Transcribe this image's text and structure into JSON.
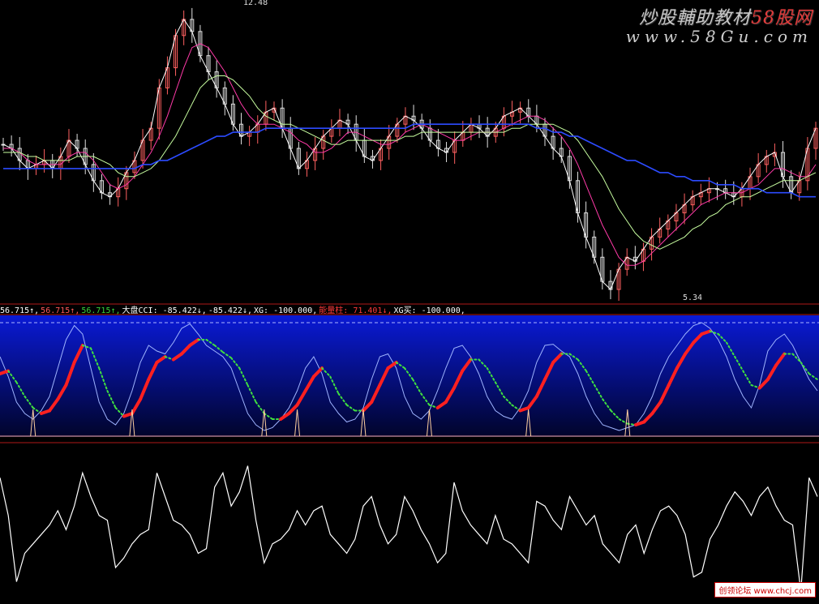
{
  "watermark": {
    "brand_main": "炒股輔助教材",
    "brand_accent": "58股网",
    "url": "www.58Gu.com"
  },
  "credit": "创领论坛 www.chcj.com",
  "labels": {
    "high": "12.48",
    "low": "5.34"
  },
  "legend": [
    {
      "text": "56.715↑",
      "color": "#ffffff"
    },
    {
      "text": "56.715↑",
      "color": "#ff5a5a"
    },
    {
      "text": "56.715↑",
      "color": "#3ad23a"
    },
    {
      "text": "大盘CCI: -85.422↓",
      "color": "#ffffff"
    },
    {
      "text": "-85.422↓",
      "color": "#ffffff"
    },
    {
      "text": "XG: -100.000",
      "color": "#ffffff"
    },
    {
      "text": "能量柱: 71.401↓",
      "color": "#ff3b3b"
    },
    {
      "text": "XG买: -100.000",
      "color": "#ffffff"
    }
  ],
  "colors": {
    "price": "#ffffff",
    "ma5": "#ffffff",
    "ma10": "#ff3aa8",
    "ma20": "#c8ffa0",
    "ma60": "#2c4bff",
    "osc_rise": "#ff2020",
    "osc_fall": "#40e040",
    "osc_thin": "#9fb4ff",
    "panel_grad_top": "#0a1ad6",
    "panel_grad_bottom": "#01042a"
  },
  "chart_data": [
    {
      "type": "line",
      "title": "",
      "ylim": [
        5.34,
        12.48
      ],
      "x": [
        0,
        1,
        2,
        3,
        4,
        5,
        6,
        7,
        8,
        9,
        10,
        11,
        12,
        13,
        14,
        15,
        16,
        17,
        18,
        19,
        20,
        21,
        22,
        23,
        24,
        25,
        26,
        27,
        28,
        29,
        30,
        31,
        32,
        33,
        34,
        35,
        36,
        37,
        38,
        39,
        40,
        41,
        42,
        43,
        44,
        45,
        46,
        47,
        48,
        49,
        50,
        51,
        52,
        53,
        54,
        55,
        56,
        57,
        58,
        59,
        60,
        61,
        62,
        63,
        64,
        65,
        66,
        67,
        68,
        69,
        70,
        71,
        72,
        73,
        74,
        75,
        76,
        77,
        78,
        79,
        80,
        81,
        82,
        83,
        84,
        85,
        86,
        87,
        88,
        89,
        90,
        91,
        92,
        93,
        94,
        95,
        96,
        97,
        98,
        99
      ],
      "series": [
        {
          "values": [
            9.1,
            9.0,
            8.7,
            8.5,
            8.6,
            8.7,
            8.5,
            8.8,
            9.2,
            9.0,
            8.6,
            8.2,
            7.9,
            7.8,
            8.0,
            8.4,
            8.7,
            9.2,
            9.5,
            10.5,
            11.0,
            11.8,
            12.2,
            11.9,
            11.3,
            10.9,
            10.5,
            10.1,
            9.6,
            9.3,
            9.4,
            9.6,
            9.9,
            10.0,
            9.5,
            9.0,
            8.5,
            8.7,
            9.0,
            9.3,
            9.5,
            9.7,
            9.6,
            9.2,
            8.8,
            8.7,
            9.0,
            9.3,
            9.6,
            9.8,
            9.7,
            9.5,
            9.2,
            9.0,
            8.9,
            9.2,
            9.4,
            9.6,
            9.5,
            9.3,
            9.5,
            9.8,
            9.9,
            10.0,
            9.8,
            9.6,
            9.3,
            9.0,
            8.8,
            8.2,
            7.4,
            6.8,
            6.3,
            5.7,
            5.5,
            6.0,
            6.3,
            6.2,
            6.5,
            6.8,
            7.0,
            7.2,
            7.4,
            7.6,
            7.8,
            7.9,
            8.0,
            8.0,
            7.9,
            7.8,
            8.0,
            8.3,
            8.6,
            8.8,
            8.9,
            8.3,
            7.9,
            8.2,
            9.0,
            9.5
          ]
        },
        {
          "values": [
            9.0,
            9.0,
            8.9,
            8.7,
            8.6,
            8.6,
            8.6,
            8.6,
            8.8,
            8.9,
            8.9,
            8.7,
            8.4,
            8.1,
            8.0,
            8.1,
            8.3,
            8.6,
            8.9,
            9.3,
            9.8,
            10.4,
            11.0,
            11.5,
            11.6,
            11.5,
            11.2,
            10.9,
            10.5,
            10.1,
            9.8,
            9.6,
            9.6,
            9.6,
            9.5,
            9.4,
            9.2,
            9.1,
            8.9,
            8.9,
            9.0,
            9.2,
            9.4,
            9.4,
            9.3,
            9.2,
            9.1,
            9.1,
            9.2,
            9.4,
            9.5,
            9.6,
            9.5,
            9.4,
            9.3,
            9.2,
            9.2,
            9.3,
            9.4,
            9.4,
            9.4,
            9.5,
            9.6,
            9.7,
            9.8,
            9.8,
            9.7,
            9.5,
            9.3,
            9.0,
            8.6,
            8.1,
            7.6,
            7.1,
            6.7,
            6.3,
            6.1,
            6.1,
            6.2,
            6.4,
            6.6,
            6.8,
            7.0,
            7.2,
            7.4,
            7.6,
            7.7,
            7.8,
            7.9,
            7.9,
            7.9,
            8.0,
            8.1,
            8.3,
            8.5,
            8.5,
            8.4,
            8.3,
            8.3,
            8.6
          ]
        },
        {
          "values": [
            8.9,
            8.9,
            8.9,
            8.8,
            8.8,
            8.7,
            8.7,
            8.7,
            8.7,
            8.8,
            8.8,
            8.8,
            8.7,
            8.6,
            8.4,
            8.3,
            8.3,
            8.4,
            8.5,
            8.7,
            9.0,
            9.3,
            9.7,
            10.1,
            10.5,
            10.7,
            10.8,
            10.8,
            10.7,
            10.5,
            10.3,
            10.0,
            9.8,
            9.7,
            9.6,
            9.6,
            9.5,
            9.4,
            9.3,
            9.2,
            9.1,
            9.1,
            9.2,
            9.2,
            9.2,
            9.2,
            9.2,
            9.2,
            9.2,
            9.3,
            9.3,
            9.4,
            9.4,
            9.4,
            9.4,
            9.4,
            9.4,
            9.4,
            9.4,
            9.4,
            9.4,
            9.4,
            9.5,
            9.5,
            9.6,
            9.6,
            9.6,
            9.6,
            9.5,
            9.4,
            9.2,
            8.9,
            8.6,
            8.3,
            7.9,
            7.5,
            7.2,
            6.9,
            6.7,
            6.6,
            6.5,
            6.6,
            6.7,
            6.8,
            7.0,
            7.1,
            7.3,
            7.4,
            7.6,
            7.7,
            7.8,
            7.8,
            7.9,
            8.0,
            8.1,
            8.2,
            8.2,
            8.2,
            8.3,
            8.4
          ]
        },
        {
          "values": [
            8.5,
            8.5,
            8.5,
            8.5,
            8.5,
            8.5,
            8.5,
            8.5,
            8.5,
            8.5,
            8.5,
            8.5,
            8.5,
            8.5,
            8.5,
            8.5,
            8.5,
            8.6,
            8.6,
            8.7,
            8.7,
            8.8,
            8.9,
            9.0,
            9.1,
            9.2,
            9.3,
            9.3,
            9.4,
            9.4,
            9.4,
            9.4,
            9.5,
            9.5,
            9.5,
            9.5,
            9.5,
            9.5,
            9.5,
            9.5,
            9.5,
            9.5,
            9.5,
            9.5,
            9.5,
            9.5,
            9.5,
            9.5,
            9.5,
            9.5,
            9.6,
            9.6,
            9.6,
            9.6,
            9.6,
            9.6,
            9.6,
            9.6,
            9.6,
            9.6,
            9.6,
            9.6,
            9.6,
            9.6,
            9.6,
            9.5,
            9.5,
            9.4,
            9.4,
            9.3,
            9.3,
            9.2,
            9.1,
            9.0,
            8.9,
            8.8,
            8.7,
            8.7,
            8.6,
            8.5,
            8.4,
            8.4,
            8.3,
            8.3,
            8.2,
            8.2,
            8.2,
            8.1,
            8.1,
            8.1,
            8.0,
            8.0,
            8.0,
            7.9,
            7.9,
            7.9,
            7.9,
            7.8,
            7.8,
            7.8
          ]
        }
      ]
    },
    {
      "type": "line",
      "title": "",
      "ylim": [
        -100,
        100
      ],
      "x": [
        0,
        1,
        2,
        3,
        4,
        5,
        6,
        7,
        8,
        9,
        10,
        11,
        12,
        13,
        14,
        15,
        16,
        17,
        18,
        19,
        20,
        21,
        22,
        23,
        24,
        25,
        26,
        27,
        28,
        29,
        30,
        31,
        32,
        33,
        34,
        35,
        36,
        37,
        38,
        39,
        40,
        41,
        42,
        43,
        44,
        45,
        46,
        47,
        48,
        49,
        50,
        51,
        52,
        53,
        54,
        55,
        56,
        57,
        58,
        59,
        60,
        61,
        62,
        63,
        64,
        65,
        66,
        67,
        68,
        69,
        70,
        71,
        72,
        73,
        74,
        75,
        76,
        77,
        78,
        79,
        80,
        81,
        82,
        83,
        84,
        85,
        86,
        87,
        88,
        89,
        90,
        91,
        92,
        93,
        94,
        95,
        96,
        97,
        98,
        99
      ],
      "series": [
        {
          "values": [
            40,
            5,
            -40,
            -60,
            -70,
            -55,
            -30,
            20,
            70,
            95,
            80,
            20,
            -40,
            -70,
            -80,
            -60,
            -20,
            30,
            60,
            50,
            45,
            65,
            90,
            98,
            80,
            60,
            50,
            40,
            20,
            -20,
            -60,
            -80,
            -90,
            -85,
            -70,
            -50,
            -20,
            20,
            40,
            10,
            -40,
            -60,
            -75,
            -70,
            -50,
            0,
            40,
            45,
            20,
            -30,
            -60,
            -70,
            -55,
            -20,
            20,
            55,
            60,
            40,
            10,
            -30,
            -55,
            -65,
            -70,
            -50,
            -20,
            30,
            60,
            62,
            50,
            40,
            10,
            -30,
            -60,
            -80,
            -85,
            -90,
            -85,
            -80,
            -60,
            -30,
            10,
            40,
            60,
            80,
            95,
            100,
            90,
            70,
            40,
            0,
            -30,
            -50,
            -10,
            50,
            70,
            80,
            60,
            30,
            0,
            -20
          ]
        },
        {
          "values": [
            10,
            15,
            -5,
            -30,
            -50,
            -60,
            -55,
            -35,
            -10,
            30,
            60,
            55,
            20,
            -20,
            -50,
            -65,
            -60,
            -35,
            0,
            30,
            40,
            35,
            45,
            60,
            70,
            70,
            60,
            48,
            38,
            20,
            -10,
            -40,
            -60,
            -70,
            -70,
            -60,
            -45,
            -20,
            5,
            20,
            5,
            -25,
            -45,
            -55,
            -55,
            -40,
            -10,
            20,
            30,
            20,
            0,
            -25,
            -45,
            -50,
            -40,
            -15,
            15,
            35,
            35,
            20,
            -5,
            -30,
            -45,
            -55,
            -50,
            -30,
            0,
            30,
            45,
            45,
            35,
            15,
            -10,
            -35,
            -55,
            -70,
            -78,
            -80,
            -75,
            -60,
            -40,
            -10,
            20,
            45,
            65,
            80,
            85,
            80,
            65,
            40,
            15,
            -10,
            -15,
            0,
            25,
            45,
            45,
            30,
            10,
            0
          ]
        }
      ]
    },
    {
      "type": "line",
      "title": "",
      "ylim": [
        -150,
        150
      ],
      "x": [
        0,
        1,
        2,
        3,
        4,
        5,
        6,
        7,
        8,
        9,
        10,
        11,
        12,
        13,
        14,
        15,
        16,
        17,
        18,
        19,
        20,
        21,
        22,
        23,
        24,
        25,
        26,
        27,
        28,
        29,
        30,
        31,
        32,
        33,
        34,
        35,
        36,
        37,
        38,
        39,
        40,
        41,
        42,
        43,
        44,
        45,
        46,
        47,
        48,
        49,
        50,
        51,
        52,
        53,
        54,
        55,
        56,
        57,
        58,
        59,
        60,
        61,
        62,
        63,
        64,
        65,
        66,
        67,
        68,
        69,
        70,
        71,
        72,
        73,
        74,
        75,
        76,
        77,
        78,
        79,
        80,
        81,
        82,
        83,
        84,
        85,
        86,
        87,
        88,
        89,
        90,
        91,
        92,
        93,
        94,
        95,
        96,
        97,
        98,
        99
      ],
      "series": [
        {
          "values": [
            100,
            20,
            -120,
            -60,
            -40,
            -20,
            0,
            30,
            -10,
            40,
            110,
            60,
            20,
            10,
            -90,
            -70,
            -40,
            -20,
            -10,
            110,
            60,
            10,
            0,
            -20,
            -60,
            -50,
            80,
            110,
            40,
            70,
            125,
            10,
            -80,
            -40,
            -30,
            -10,
            30,
            0,
            30,
            40,
            -20,
            -40,
            -60,
            -30,
            40,
            60,
            0,
            -40,
            -20,
            60,
            30,
            -10,
            -40,
            -80,
            -60,
            90,
            30,
            0,
            -20,
            -40,
            20,
            -30,
            -40,
            -60,
            -80,
            50,
            40,
            10,
            -10,
            60,
            30,
            0,
            20,
            -40,
            -60,
            -80,
            -20,
            0,
            -60,
            -10,
            30,
            40,
            20,
            -20,
            -110,
            -100,
            -30,
            0,
            40,
            70,
            50,
            20,
            60,
            80,
            40,
            10,
            0,
            -140,
            100,
            60
          ]
        }
      ]
    }
  ]
}
